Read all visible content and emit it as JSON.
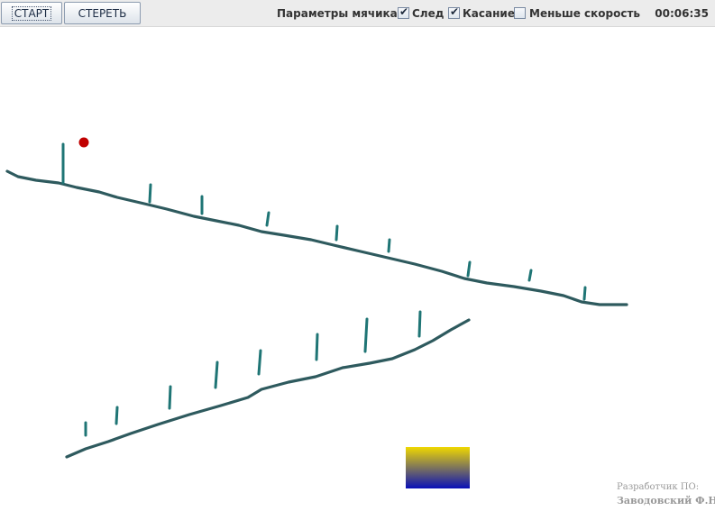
{
  "toolbar": {
    "start_label": "СТАРТ",
    "erase_label": "СТЕРЕТЬ",
    "params_label": "Параметры мячика:",
    "options": [
      {
        "label": "След",
        "checked": true
      },
      {
        "label": "Касание",
        "checked": true
      },
      {
        "label": "Меньше скорость",
        "checked": false
      }
    ],
    "timer": "00:06:35"
  },
  "scene": {
    "ball_color": "#c00000",
    "line_color": "#2e5a5e",
    "stick_color": "#1f7575",
    "gradient_colors": [
      "#f0d800",
      "#0a10b8"
    ]
  },
  "credits": {
    "line1": "Разработчик ПО:",
    "line2": "Заводовский Ф.Н."
  }
}
